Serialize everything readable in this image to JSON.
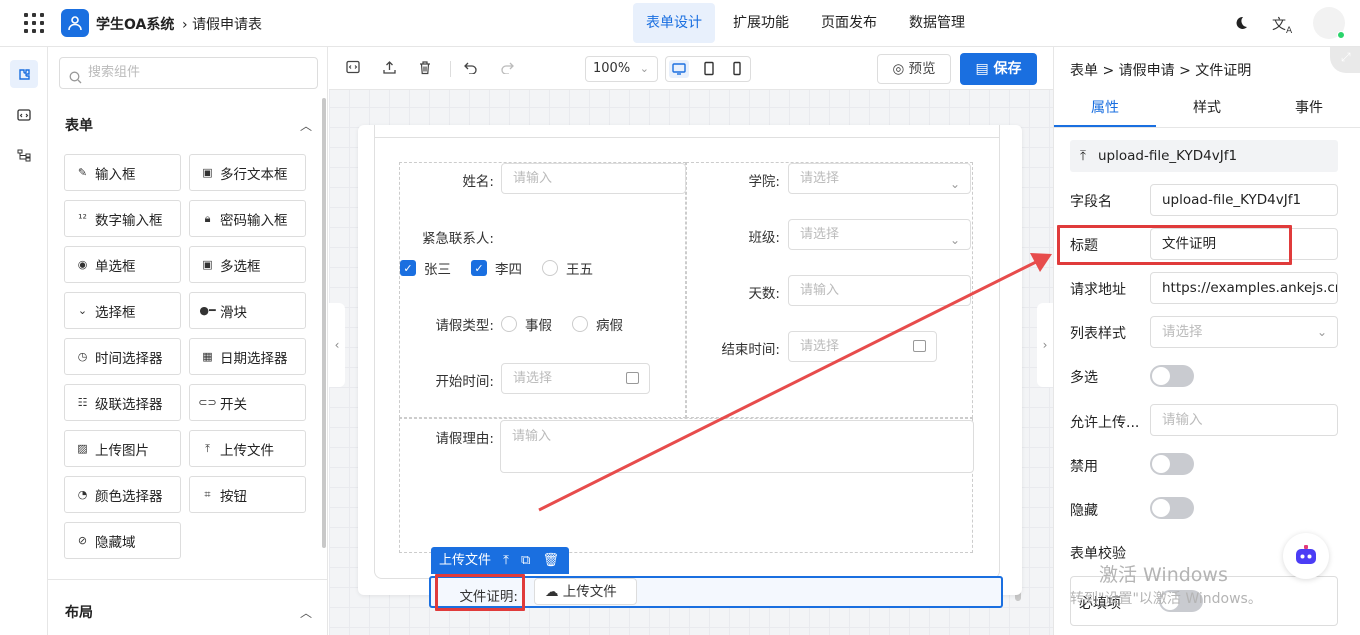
{
  "app": {
    "name": "学生OA系统",
    "breadcrumb": "请假申请表"
  },
  "nav": {
    "tabs": [
      "表单设计",
      "扩展功能",
      "页面发布",
      "数据管理"
    ],
    "active_index": 0
  },
  "components": {
    "search_placeholder": "搜索组件",
    "form_section": "表单",
    "items": [
      "输入框",
      "多行文本框",
      "数字输入框",
      "密码输入框",
      "单选框",
      "多选框",
      "选择框",
      "滑块",
      "时间选择器",
      "日期选择器",
      "级联选择器",
      "开关",
      "上传图片",
      "上传文件",
      "颜色选择器",
      "按钮",
      "隐藏域"
    ],
    "layout_section": "布局"
  },
  "toolbar": {
    "zoom": "100%",
    "preview_label": "预览",
    "save_label": "保存"
  },
  "form": {
    "name_label": "姓名:",
    "name_placeholder": "请输入",
    "college_label": "学院:",
    "college_placeholder": "请选择",
    "contact_label": "紧急联系人:",
    "contacts": [
      {
        "label": "张三",
        "checked": true
      },
      {
        "label": "李四",
        "checked": true
      },
      {
        "label": "王五",
        "checked": false
      }
    ],
    "class_label": "班级:",
    "class_placeholder": "请选择",
    "days_label": "天数:",
    "days_placeholder": "请输入",
    "leave_type_label": "请假类型:",
    "leave_types": [
      "事假",
      "病假"
    ],
    "end_time_label": "结束时间:",
    "end_time_placeholder": "请选择",
    "start_time_label": "开始时间:",
    "start_time_placeholder": "请选择",
    "reason_label": "请假理由:",
    "reason_placeholder": "请输入",
    "selected_chip": "上传文件",
    "file_label": "文件证明:",
    "upload_button": "上传文件"
  },
  "properties": {
    "breadcrumb": "表单 > 请假申请 > 文件证明",
    "tabs": [
      "属性",
      "样式",
      "事件"
    ],
    "component_id": "upload-file_KYD4vJf1",
    "field_name_label": "字段名",
    "field_name_value": "upload-file_KYD4vJf1",
    "title_label": "标题",
    "title_value": "文件证明",
    "url_label": "请求地址",
    "url_value": "https://examples.ankejs.cn/",
    "list_style_label": "列表样式",
    "list_style_placeholder": "请选择",
    "multiple_label": "多选",
    "allow_upload_label": "允许上传...",
    "allow_upload_placeholder": "请输入",
    "disabled_label": "禁用",
    "hidden_label": "隐藏",
    "validation_label": "表单校验",
    "required_label": "必填项"
  },
  "watermark": {
    "line1": "激活 Windows",
    "line2": "转到\"设置\"以激活 Windows。"
  }
}
